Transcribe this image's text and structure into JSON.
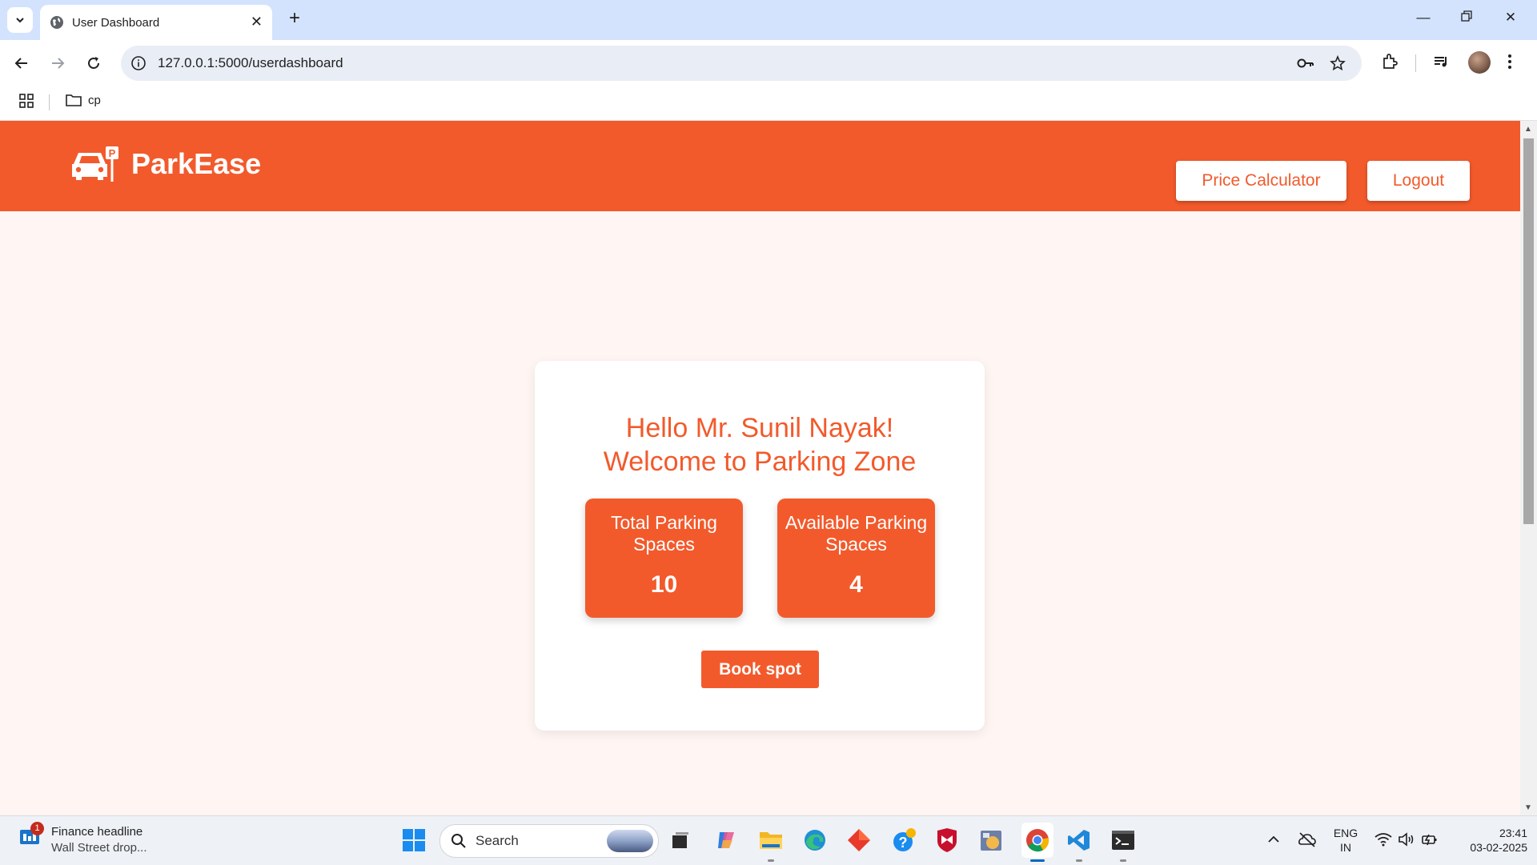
{
  "browser": {
    "tab_title": "User Dashboard",
    "url": "127.0.0.1:5000/userdashboard",
    "bookmark_folder": "cp"
  },
  "site": {
    "brand": "ParkEase",
    "nav": {
      "price_calculator": "Price Calculator",
      "logout": "Logout"
    },
    "greeting_line1": "Hello Mr. Sunil Nayak!",
    "greeting_line2": "Welcome to Parking Zone",
    "stats": [
      {
        "label": "Total Parking Spaces",
        "value": "10"
      },
      {
        "label": "Available Parking Spaces",
        "value": "4"
      }
    ],
    "book_button": "Book spot",
    "colors": {
      "accent": "#f25a2c",
      "background": "#fff5f2"
    }
  },
  "taskbar": {
    "news_badge": "1",
    "news_title": "Finance headline",
    "news_sub": "Wall Street drop...",
    "search_label": "Search",
    "lang_top": "ENG",
    "lang_bottom": "IN",
    "time": "23:41",
    "date": "03-02-2025"
  }
}
